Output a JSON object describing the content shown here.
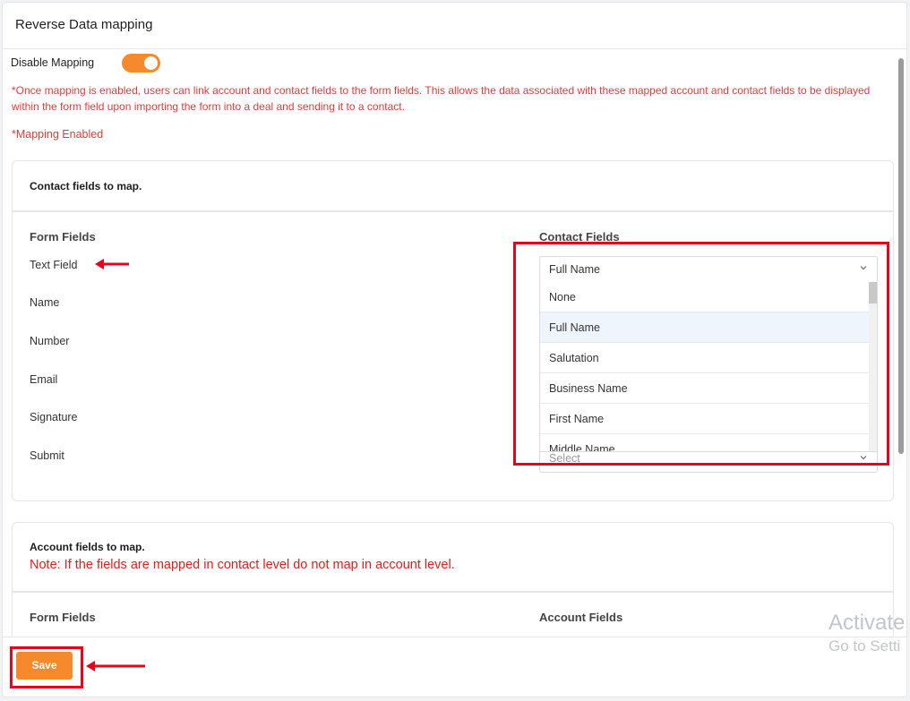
{
  "modal": {
    "title": "Reverse Data mapping"
  },
  "toggle": {
    "label": "Disable Mapping",
    "state": "on",
    "color": "#f5892b"
  },
  "notice": "*Once mapping is enabled, users can link account and contact fields to the form fields. This allows the data associated with these mapped account and contact fields to be displayed within the form field upon importing the form into a deal and sending it to a contact.",
  "status_note": "*Mapping Enabled",
  "contact_card": {
    "title": "Contact fields to map.",
    "form_fields_header": "Form Fields",
    "contact_fields_header": "Contact Fields",
    "form_fields": [
      "Text Field",
      "Name",
      "Number",
      "Email",
      "Signature",
      "Submit"
    ],
    "select_value": "Full Name",
    "select_placeholder": "Select",
    "dropdown_options": [
      "None",
      "Full Name",
      "Salutation",
      "Business Name",
      "First Name",
      "Middle Name"
    ],
    "dropdown_selected": "Full Name"
  },
  "account_card": {
    "title": "Account fields to map.",
    "note": "Note: If the fields are mapped in contact level do not map in account level.",
    "form_fields_header": "Form Fields",
    "account_fields_header": "Account Fields"
  },
  "footer": {
    "save_label": "Save"
  },
  "watermark": {
    "line1": "Activate",
    "line2": "Go to Setti"
  },
  "colors": {
    "accent": "#f5892b",
    "warning": "#e13a3a",
    "highlight": "#e3061b"
  }
}
